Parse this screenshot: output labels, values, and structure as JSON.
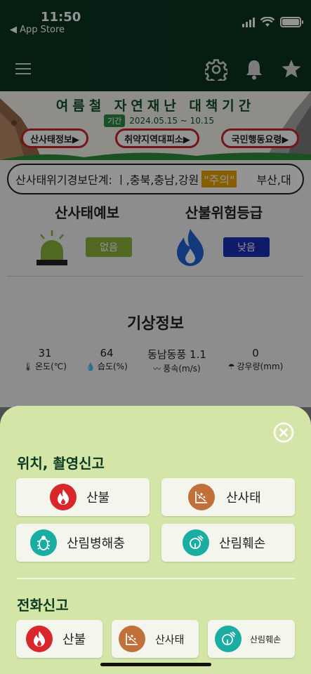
{
  "status_bar": {
    "time": "11:50",
    "back_label": "◀ App Store"
  },
  "header": {
    "menu_icon": "hamburger-menu-icon",
    "icons": [
      "gear-icon",
      "bell-icon",
      "star-icon"
    ]
  },
  "banner": {
    "title": "여름철 자연재난 대책기간",
    "period_tag": "기간",
    "period_dates": "2024.05.15 ~ 10.15",
    "buttons": [
      "산사태정보▶",
      "취약지역대피소▶",
      "국민행동요령▶"
    ]
  },
  "ticker": {
    "prefix": "산사태위기경보단계: ㅣ,충북,충남,강원",
    "level": "\"주의\"",
    "next": "부산,대"
  },
  "forecast": {
    "landslide_title": "산사태예보",
    "landslide_level": "없음",
    "landslide_color": "#8ab33a",
    "fire_title": "산불위험등급",
    "fire_level": "낮음",
    "fire_color": "#1a2eb8"
  },
  "weather": {
    "title": "기상정보",
    "items": [
      {
        "value": "31",
        "label": "온도(℃)",
        "icon": "thermometer-icon"
      },
      {
        "value": "64",
        "label": "습도(%)",
        "icon": "humidity-icon"
      },
      {
        "value": "동남동풍 1.1",
        "label": "풍속(m/s)",
        "icon": "wind-icon"
      },
      {
        "value": "0",
        "label": "강우량(mm)",
        "icon": "rain-icon"
      }
    ]
  },
  "sheet": {
    "section1_title": "위치, 촬영신고",
    "section1_buttons": [
      {
        "label": "산불",
        "icon": "fire-icon",
        "color": "#d8262b"
      },
      {
        "label": "산사태",
        "icon": "landslide-icon",
        "color": "#c07038"
      },
      {
        "label": "산림병해충",
        "icon": "pest-icon",
        "color": "#1aaea2"
      },
      {
        "label": "산림훼손",
        "icon": "tree-damage-icon",
        "color": "#1aaea2"
      }
    ],
    "section2_title": "전화신고",
    "section2_buttons": [
      {
        "label": "산불",
        "icon": "fire-icon",
        "color": "#d8262b"
      },
      {
        "label": "산사태",
        "icon": "landslide-icon",
        "color": "#c07038"
      },
      {
        "label": "산림훼손",
        "icon": "tree-damage-icon",
        "color": "#1aaea2"
      }
    ]
  }
}
